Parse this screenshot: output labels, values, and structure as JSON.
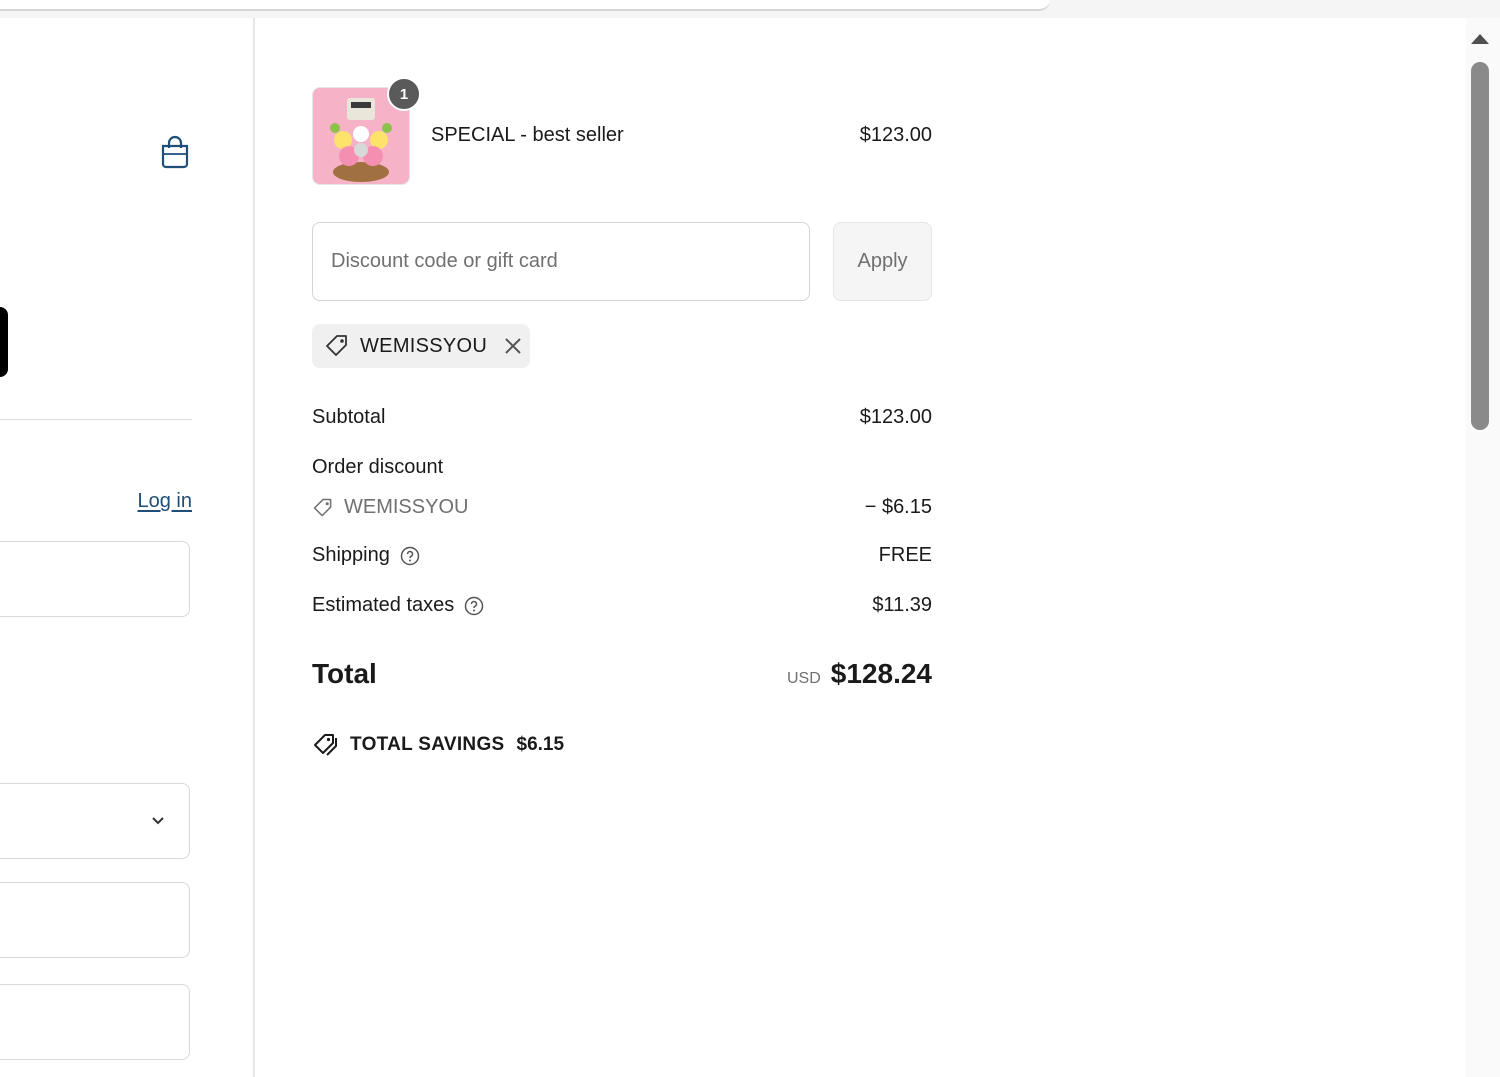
{
  "left": {
    "login_label": "Log in"
  },
  "product": {
    "name": "SPECIAL - best seller",
    "price": "$123.00",
    "quantity": "1",
    "thumbnail_icon": "flower-arrangement-image"
  },
  "discount": {
    "placeholder": "Discount code or gift card",
    "apply_label": "Apply",
    "applied_code": "WEMISSYOU"
  },
  "summary": {
    "subtotal_label": "Subtotal",
    "subtotal_value": "$123.00",
    "order_discount_label": "Order discount",
    "discount_code": "WEMISSYOU",
    "discount_value": "− $6.15",
    "shipping_label": "Shipping",
    "shipping_value": "FREE",
    "taxes_label": "Estimated taxes",
    "taxes_value": "$11.39",
    "total_label": "Total",
    "currency": "USD",
    "total_value": "$128.24",
    "savings_label": "TOTAL SAVINGS",
    "savings_value": "$6.15"
  },
  "colors": {
    "link": "#1f4e79",
    "muted_text": "#707070",
    "badge": "#5a5a5a"
  }
}
